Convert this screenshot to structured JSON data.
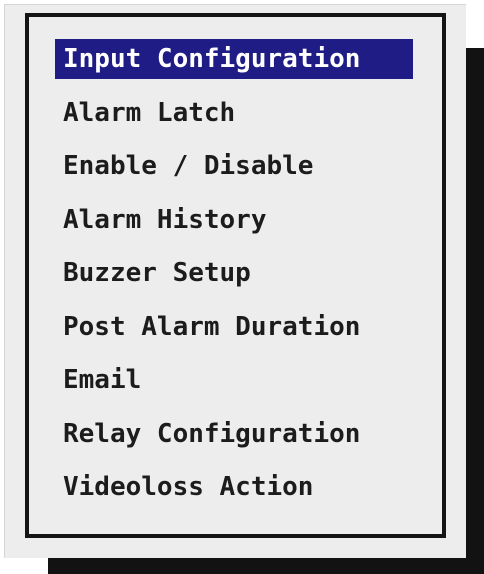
{
  "menu": {
    "selected_index": 0,
    "items": [
      {
        "label": "Input Configuration"
      },
      {
        "label": "Alarm Latch"
      },
      {
        "label": "Enable / Disable"
      },
      {
        "label": "Alarm History"
      },
      {
        "label": "Buzzer Setup"
      },
      {
        "label": "Post Alarm Duration"
      },
      {
        "label": "Email"
      },
      {
        "label": "Relay Configuration"
      },
      {
        "label": "Videoloss Action"
      }
    ]
  },
  "colors": {
    "panel_background": "#ededed",
    "frame": "#141414",
    "drop_shadow": "#121212",
    "selection_highlight": "#1f1c85",
    "selected_text": "#ffffff",
    "item_text": "#1c1c1c"
  }
}
